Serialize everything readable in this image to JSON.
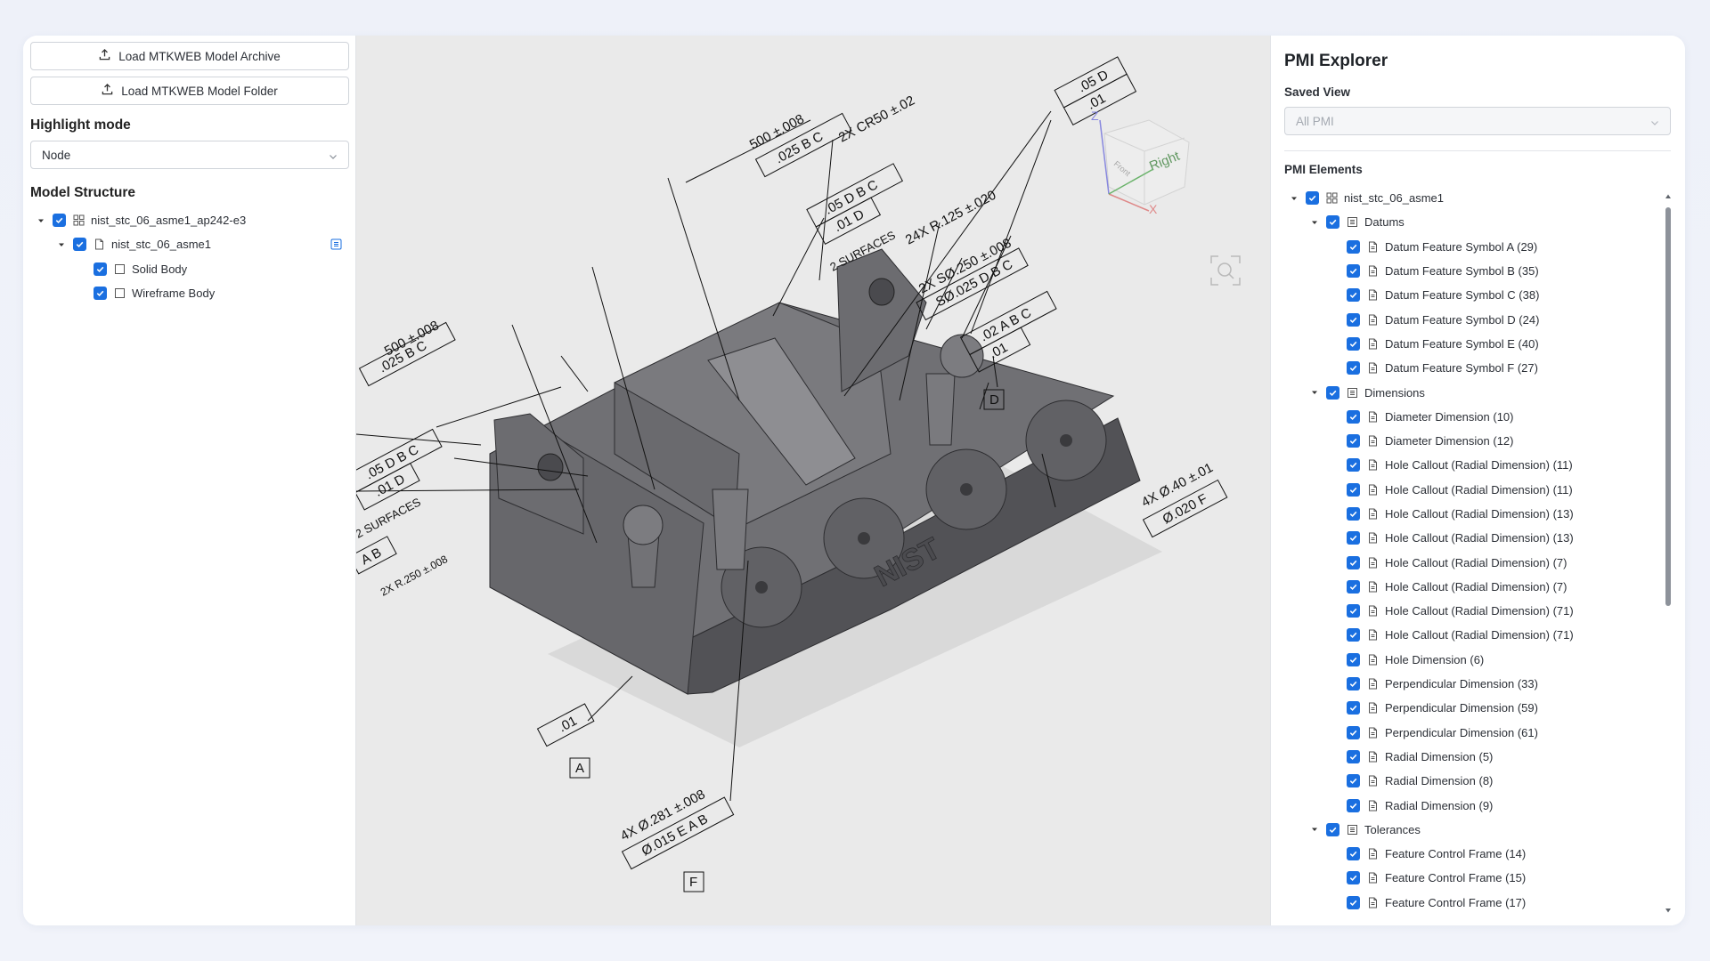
{
  "left_panel": {
    "load_archive_label": "Load MTKWEB Model Archive",
    "load_folder_label": "Load MTKWEB Model Folder",
    "highlight_mode_title": "Highlight mode",
    "highlight_mode_value": "Node",
    "model_structure_title": "Model Structure",
    "tree": [
      {
        "label": "nist_stc_06_asme1_ap242-e3",
        "level": 0,
        "caret": true,
        "checked": true,
        "icon": "assembly-icon"
      },
      {
        "label": "nist_stc_06_asme1",
        "level": 1,
        "caret": true,
        "checked": true,
        "icon": "part-icon"
      },
      {
        "label": "Solid Body",
        "level": 2,
        "caret": false,
        "checked": true,
        "icon": "body-icon"
      },
      {
        "label": "Wireframe Body",
        "level": 2,
        "caret": false,
        "checked": true,
        "icon": "body-icon"
      }
    ]
  },
  "viewport": {
    "view_cube_right": "Right",
    "view_cube_front": "Front",
    "axis_x": "X",
    "axis_z": "Z",
    "part_engraving": "NIST",
    "annotations": {
      "dim_500_top": "500 ±.008",
      "frame_025_bc": ".025 B C",
      "cr50": "2X CR50 ±.02",
      "frame_05_dbc": ".05 D B C",
      "frame_01_d": ".01 D",
      "two_surfaces": "2 SURFACES",
      "r125": "24X R.125 ±.020",
      "s0250": "2X SØ.250 ±.008",
      "frame_s025": "SØ.025 D B C",
      "frame_05_d_top": ".05 D",
      "frame_01_top": ".01",
      "frame_02_abc": ".02 A B C",
      "frame_01_right": ".01",
      "datum_d": "D",
      "dim_500_left": "500 ±.008",
      "frame_025_bc_left": ".025 B C",
      "frame_05_dbc_left": ".05 D B C",
      "frame_01_d_left": ".01 D",
      "surfaces_left": "2 SURFACES",
      "datum_ab": "A B",
      "r250": "2X R.250 ±.008",
      "hole_040": "4X Ø.40 ±.01",
      "frame_020_f": "Ø.020 F",
      "frame_01_bottom": ".01",
      "datum_a": "A",
      "hole_281": "4X Ø.281 ±.008",
      "frame_015_eab": "Ø.015 E A B",
      "datum_f": "F"
    }
  },
  "right_panel": {
    "title": "PMI Explorer",
    "saved_view_label": "Saved View",
    "saved_view_value": "All PMI",
    "pmi_elements_label": "PMI Elements",
    "tree": [
      {
        "label": "nist_stc_06_asme1",
        "level": 0,
        "caret": true,
        "icon": "assembly-icon"
      },
      {
        "label": "Datums",
        "level": 1,
        "caret": true,
        "icon": "group-icon"
      },
      {
        "label": "Datum Feature Symbol A (29)",
        "level": 2,
        "icon": "document-icon"
      },
      {
        "label": "Datum Feature Symbol B (35)",
        "level": 2,
        "icon": "document-icon"
      },
      {
        "label": "Datum Feature Symbol C (38)",
        "level": 2,
        "icon": "document-icon"
      },
      {
        "label": "Datum Feature Symbol D (24)",
        "level": 2,
        "icon": "document-icon"
      },
      {
        "label": "Datum Feature Symbol E (40)",
        "level": 2,
        "icon": "document-icon"
      },
      {
        "label": "Datum Feature Symbol F (27)",
        "level": 2,
        "icon": "document-icon"
      },
      {
        "label": "Dimensions",
        "level": 1,
        "caret": true,
        "icon": "group-icon"
      },
      {
        "label": "Diameter Dimension (10)",
        "level": 2,
        "icon": "document-icon"
      },
      {
        "label": "Diameter Dimension (12)",
        "level": 2,
        "icon": "document-icon"
      },
      {
        "label": "Hole Callout (Radial Dimension) (11)",
        "level": 2,
        "icon": "document-icon"
      },
      {
        "label": "Hole Callout (Radial Dimension) (11)",
        "level": 2,
        "icon": "document-icon"
      },
      {
        "label": "Hole Callout (Radial Dimension) (13)",
        "level": 2,
        "icon": "document-icon"
      },
      {
        "label": "Hole Callout (Radial Dimension) (13)",
        "level": 2,
        "icon": "document-icon"
      },
      {
        "label": "Hole Callout (Radial Dimension) (7)",
        "level": 2,
        "icon": "document-icon"
      },
      {
        "label": "Hole Callout (Radial Dimension) (7)",
        "level": 2,
        "icon": "document-icon"
      },
      {
        "label": "Hole Callout (Radial Dimension) (71)",
        "level": 2,
        "icon": "document-icon"
      },
      {
        "label": "Hole Callout (Radial Dimension) (71)",
        "level": 2,
        "icon": "document-icon"
      },
      {
        "label": "Hole Dimension (6)",
        "level": 2,
        "icon": "document-icon"
      },
      {
        "label": "Perpendicular Dimension (33)",
        "level": 2,
        "icon": "document-icon"
      },
      {
        "label": "Perpendicular Dimension (59)",
        "level": 2,
        "icon": "document-icon"
      },
      {
        "label": "Perpendicular Dimension (61)",
        "level": 2,
        "icon": "document-icon"
      },
      {
        "label": "Radial Dimension (5)",
        "level": 2,
        "icon": "document-icon"
      },
      {
        "label": "Radial Dimension (8)",
        "level": 2,
        "icon": "document-icon"
      },
      {
        "label": "Radial Dimension (9)",
        "level": 2,
        "icon": "document-icon"
      },
      {
        "label": "Tolerances",
        "level": 1,
        "caret": true,
        "icon": "group-icon"
      },
      {
        "label": "Feature Control Frame (14)",
        "level": 2,
        "icon": "document-icon"
      },
      {
        "label": "Feature Control Frame (15)",
        "level": 2,
        "icon": "document-icon"
      },
      {
        "label": "Feature Control Frame (17)",
        "level": 2,
        "icon": "document-icon"
      }
    ]
  },
  "colors": {
    "accent": "#1a6fe0",
    "part_fill": "#6e6e72",
    "viewport_bg": "#eaeaea"
  }
}
